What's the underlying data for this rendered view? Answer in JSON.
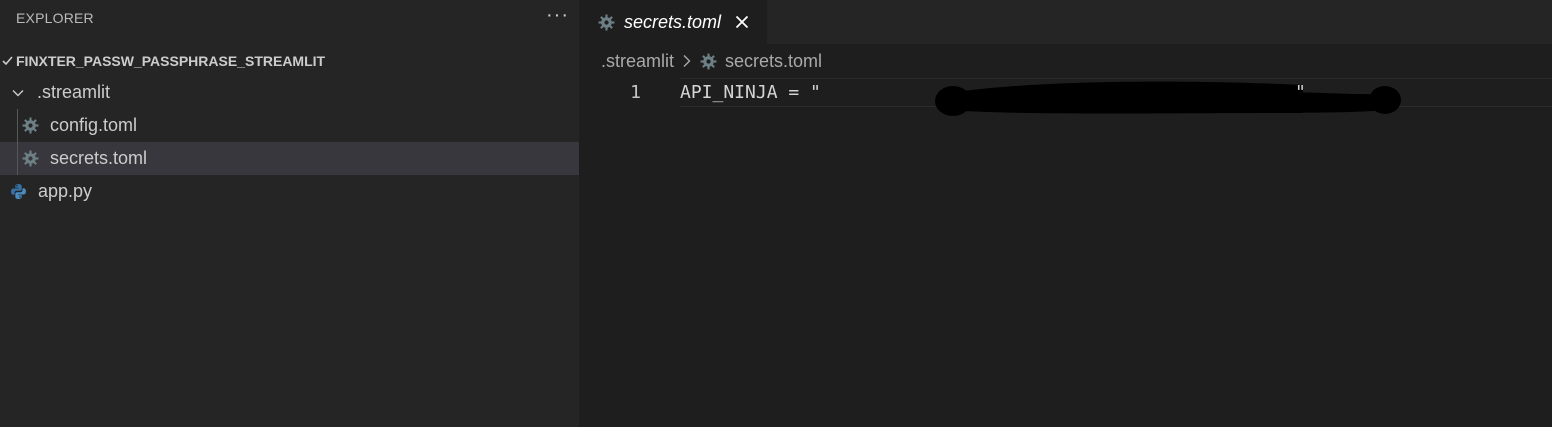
{
  "sidebar": {
    "title": "EXPLORER",
    "more_icon": "more-icon",
    "section_title": "FINXTER_PASSW_PASSPHRASE_STREAMLIT",
    "folder": {
      "label": ".streamlit",
      "icon": "chevron-down-icon",
      "items": [
        {
          "label": "config.toml",
          "icon": "gear-icon"
        },
        {
          "label": "secrets.toml",
          "icon": "gear-icon",
          "selected": true
        }
      ]
    },
    "root_file": {
      "label": "app.py",
      "icon": "python-icon"
    }
  },
  "editor": {
    "tab": {
      "label": "secrets.toml",
      "icon": "gear-icon",
      "close_icon": "close-icon"
    },
    "breadcrumb": {
      "folder": ".streamlit",
      "separator_icon": "chevron-right-icon",
      "file": "secrets.toml",
      "file_icon": "gear-icon"
    },
    "lines": [
      {
        "number": "1",
        "text": "API_NINJA = \"",
        "text_end": "\""
      }
    ]
  },
  "colors": {
    "sidebar_bg": "#252526",
    "editor_bg": "#1e1e1e",
    "selected_row": "#37373d",
    "text": "#cccccc",
    "gear": "#6d8086",
    "python_blue": "#3572a5"
  }
}
